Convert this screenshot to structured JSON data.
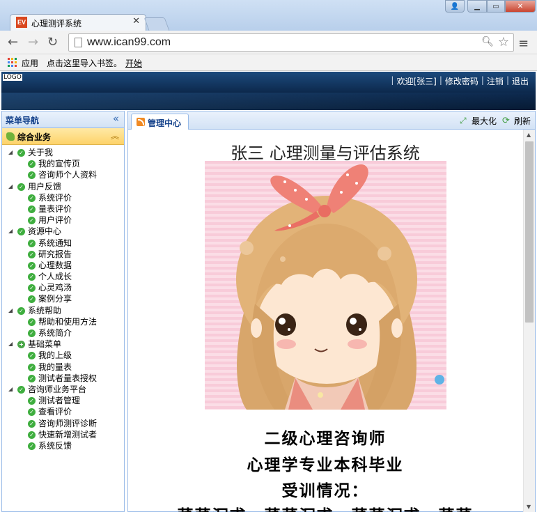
{
  "browser": {
    "tab_title": "心理测评系统",
    "tab_favicon": "EV",
    "url": "www.ican99.com",
    "bookmarks": {
      "apps": "应用",
      "import": "点击这里导入书签。",
      "start": "开始"
    }
  },
  "header": {
    "logo": "LOGO",
    "welcome": "欢迎[张三]",
    "change_password": "修改密码",
    "logout": "注销",
    "exit": "退出"
  },
  "sidebar": {
    "title": "菜单导航",
    "group": "综合业务",
    "tree": [
      {
        "label": "关于我",
        "children": [
          "我的宣传页",
          "咨询师个人资料"
        ]
      },
      {
        "label": "用户反馈",
        "children": [
          "系统评价",
          "量表评价",
          "用户评价"
        ]
      },
      {
        "label": "资源中心",
        "children": [
          "系统通知",
          "研究报告",
          "心理数据",
          "个人成长",
          "心灵鸡汤",
          "案例分享"
        ]
      },
      {
        "label": "系统帮助",
        "children": [
          "帮助和使用方法",
          "系统简介"
        ]
      },
      {
        "label": "基础菜单",
        "children": [
          "我的上级",
          "我的量表",
          "测试者量表授权"
        ]
      },
      {
        "label": "咨询师业务平台",
        "children": [
          "测试者管理",
          "查看评价",
          "咨询师测评诊断",
          "快速新增测试者",
          "系统反馈"
        ]
      }
    ]
  },
  "main": {
    "tab": "管理中心",
    "maximize": "最大化",
    "refresh": "刷新",
    "system_title": "张三 心理测量与评估系统",
    "intro": [
      "二级心理咨询师",
      "心理学专业本科毕业",
      "受训情况：",
      "菜菜沉求，菜菜沉求，菜菜沉求，菜菜"
    ]
  },
  "colors": {
    "accent": "#15428b",
    "header_bg": "#0b2547",
    "group_bg": "#fdd36a",
    "check_green": "#3fae3f"
  }
}
